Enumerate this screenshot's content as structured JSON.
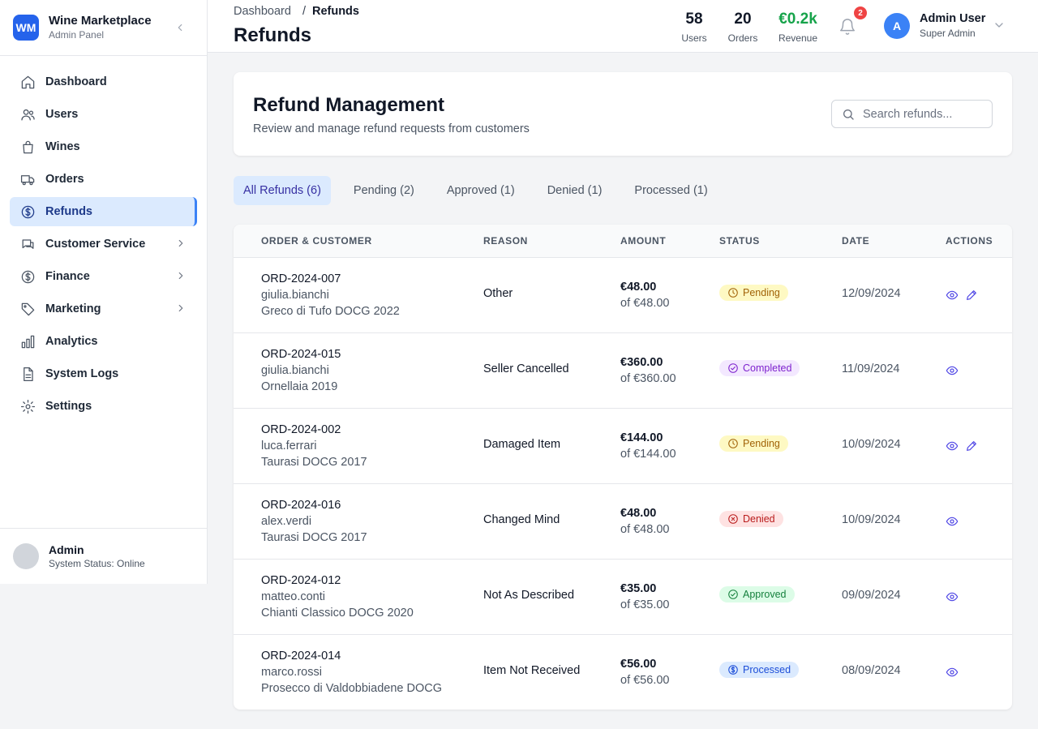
{
  "brand": {
    "logo": "WM",
    "name": "Wine Marketplace",
    "subtitle": "Admin Panel"
  },
  "sidebar": {
    "items": [
      {
        "label": "Dashboard",
        "icon": "home-icon"
      },
      {
        "label": "Users",
        "icon": "users-icon"
      },
      {
        "label": "Wines",
        "icon": "bag-icon"
      },
      {
        "label": "Orders",
        "icon": "truck-icon"
      },
      {
        "label": "Refunds",
        "icon": "dollar-circle-icon",
        "active": true
      },
      {
        "label": "Customer Service",
        "icon": "chat-icon",
        "expandable": true
      },
      {
        "label": "Finance",
        "icon": "dollar-circle-icon",
        "expandable": true
      },
      {
        "label": "Marketing",
        "icon": "tag-icon",
        "expandable": true
      },
      {
        "label": "Analytics",
        "icon": "bar-chart-icon"
      },
      {
        "label": "System Logs",
        "icon": "document-icon"
      },
      {
        "label": "Settings",
        "icon": "gear-icon"
      }
    ],
    "footer": {
      "name": "Admin",
      "status": "System Status: Online"
    }
  },
  "header": {
    "breadcrumb": {
      "parent": "Dashboard",
      "separator": "/",
      "current": "Refunds"
    },
    "title": "Refunds",
    "stats": [
      {
        "value": "58",
        "label": "Users",
        "color": "#111827"
      },
      {
        "value": "20",
        "label": "Orders",
        "color": "#111827"
      },
      {
        "value": "€0.2k",
        "label": "Revenue",
        "color": "#16a34a"
      }
    ],
    "notifications": "2",
    "user": {
      "initial": "A",
      "name": "Admin User",
      "role": "Super Admin"
    }
  },
  "main": {
    "title": "Refund Management",
    "subtitle": "Review and manage refund requests from customers",
    "search_placeholder": "Search refunds..."
  },
  "tabs": [
    {
      "label": "All Refunds (6)",
      "active": true
    },
    {
      "label": "Pending (2)"
    },
    {
      "label": "Approved (1)"
    },
    {
      "label": "Denied (1)"
    },
    {
      "label": "Processed (1)"
    }
  ],
  "table": {
    "columns": [
      "ORDER & CUSTOMER",
      "REASON",
      "AMOUNT",
      "STATUS",
      "DATE",
      "ACTIONS"
    ],
    "rows": [
      {
        "order": "ORD-2024-007",
        "customer": "giulia.bianchi",
        "wine": "Greco di Tufo DOCG 2022",
        "reason": "Other",
        "amount": "€48.00",
        "of": "of €48.00",
        "status": "Pending",
        "status_kind": "pending",
        "date": "12/09/2024",
        "editable": true
      },
      {
        "order": "ORD-2024-015",
        "customer": "giulia.bianchi",
        "wine": "Ornellaia 2019",
        "reason": "Seller Cancelled",
        "amount": "€360.00",
        "of": "of €360.00",
        "status": "Completed",
        "status_kind": "completed",
        "date": "11/09/2024",
        "editable": false
      },
      {
        "order": "ORD-2024-002",
        "customer": "luca.ferrari",
        "wine": "Taurasi DOCG 2017",
        "reason": "Damaged Item",
        "amount": "€144.00",
        "of": "of €144.00",
        "status": "Pending",
        "status_kind": "pending",
        "date": "10/09/2024",
        "editable": true
      },
      {
        "order": "ORD-2024-016",
        "customer": "alex.verdi",
        "wine": "Taurasi DOCG 2017",
        "reason": "Changed Mind",
        "amount": "€48.00",
        "of": "of €48.00",
        "status": "Denied",
        "status_kind": "denied",
        "date": "10/09/2024",
        "editable": false
      },
      {
        "order": "ORD-2024-012",
        "customer": "matteo.conti",
        "wine": "Chianti Classico DOCG 2020",
        "reason": "Not As Described",
        "amount": "€35.00",
        "of": "of €35.00",
        "status": "Approved",
        "status_kind": "approved",
        "date": "09/09/2024",
        "editable": false
      },
      {
        "order": "ORD-2024-014",
        "customer": "marco.rossi",
        "wine": "Prosecco di Valdobbiadene DOCG",
        "reason": "Item Not Received",
        "amount": "€56.00",
        "of": "of €56.00",
        "status": "Processed",
        "status_kind": "processed",
        "date": "08/09/2024",
        "editable": false
      }
    ]
  },
  "status_colors": {
    "pending": {
      "bg": "#fef9c3",
      "fg": "#a16207",
      "icon": "clock-icon"
    },
    "completed": {
      "bg": "#f3e8ff",
      "fg": "#7e22ce",
      "icon": "check-circle-icon"
    },
    "denied": {
      "bg": "#fee2e2",
      "fg": "#b91c1c",
      "icon": "x-circle-icon"
    },
    "approved": {
      "bg": "#dcfce7",
      "fg": "#15803d",
      "icon": "check-circle-icon"
    },
    "processed": {
      "bg": "#dbeafe",
      "fg": "#1d4ed8",
      "icon": "dollar-circle-icon"
    }
  }
}
